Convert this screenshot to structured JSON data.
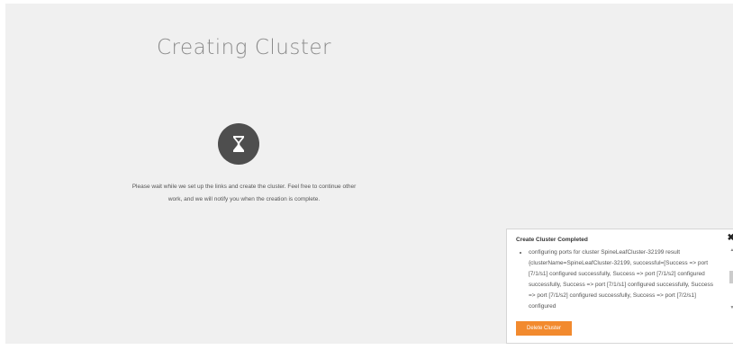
{
  "page": {
    "title": "Creating Cluster",
    "spinner_icon": "hourglass-icon",
    "message_line1": "Please wait while we set up the links and create the cluster. Feel free to continue other",
    "message_line2": "work, and we will notify you when the creation is complete."
  },
  "notification": {
    "title": "Create Cluster Completed",
    "close_icon": "close-icon",
    "items": [
      "configuring ports for cluster SpineLeafCluster-32199 result {clusterName=SpineLeafCluster-32199, successful=[Success => port [7/1/s1] configured successfully, Success => port [7/1/s2] configured successfully, Success => port [7/1/s1] configured successfully, Success => port [7/1/s2] configured successfully, Success => port [7/2/s1] configured"
    ],
    "button_label": "Delete Cluster",
    "scroll_up": "▲",
    "scroll_down": "▼"
  },
  "colors": {
    "background": "#f0f0f0",
    "spinner": "#4e4e4e",
    "button": "#f28a2e"
  }
}
